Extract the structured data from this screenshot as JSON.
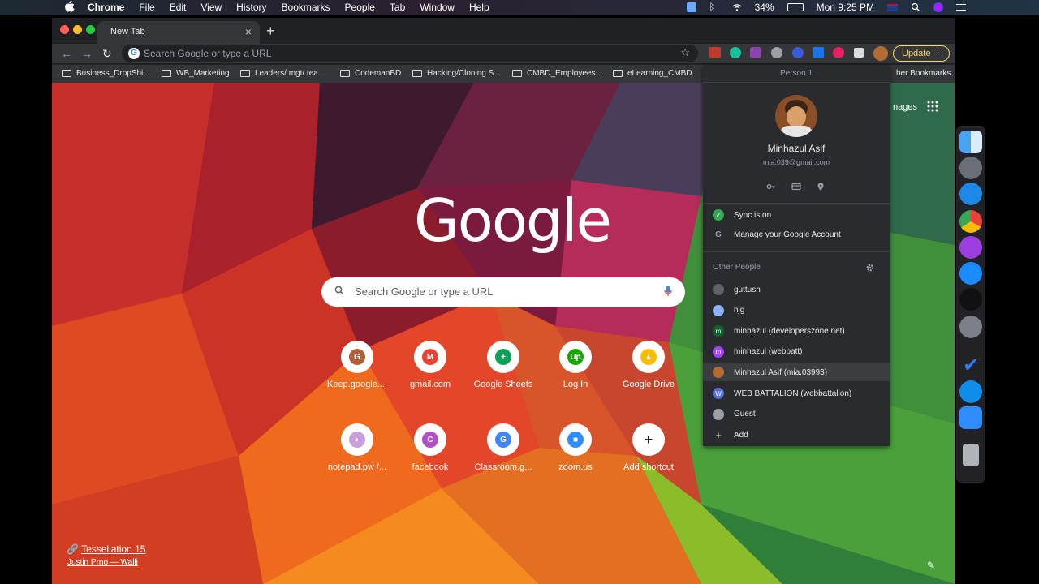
{
  "menubar": {
    "app": "Chrome",
    "menus": [
      "File",
      "Edit",
      "View",
      "History",
      "Bookmarks",
      "People",
      "Tab",
      "Window",
      "Help"
    ],
    "battery": "34%",
    "clock": "Mon 9:25 PM"
  },
  "browser": {
    "tab_title": "New Tab",
    "omnibox_placeholder": "Search Google or type a URL",
    "update_label": "Update",
    "bookmarks": [
      "Business_DropShi...",
      "WB_Marketing",
      "Leaders/ mgt/ tea...",
      "CodemanBD",
      "Hacking/Cloning S...",
      "CMBD_Employees...",
      "eLearning_CMBD"
    ],
    "other_bookmarks": "her Bookmarks"
  },
  "newtab": {
    "logo": "Google",
    "search_placeholder": "Search Google or type a URL",
    "images_link": "nages",
    "shortcuts": [
      {
        "label": "Keep.google....",
        "glyph": "G",
        "color": "#b0603a"
      },
      {
        "label": "gmail.com",
        "glyph": "M",
        "color": "#ea4335"
      },
      {
        "label": "Google Sheets",
        "glyph": "+",
        "color": "#0f9d58"
      },
      {
        "label": "Log In",
        "glyph": "Up",
        "color": "#14a800"
      },
      {
        "label": "Google Drive",
        "glyph": "▲",
        "color": "#fbbc05"
      },
      {
        "label": "notepad.pw /...",
        "glyph": "◗",
        "color": "#c9a0dc"
      },
      {
        "label": "facebook",
        "glyph": "C",
        "color": "#b04fc8"
      },
      {
        "label": "Classroom.g...",
        "glyph": "G",
        "color": "#4285f4"
      },
      {
        "label": "zoom.us",
        "glyph": "■",
        "color": "#2d8cff"
      },
      {
        "label": "Add shortcut",
        "glyph": "+",
        "color": "#202124"
      }
    ],
    "credit_title": "Tessellation 15",
    "credit_author": "Justin Prno — Walli"
  },
  "profile_panel": {
    "header": "Person 1",
    "name": "Minhazul Asif",
    "email": "mia.039@gmail.com",
    "sync": "Sync is on",
    "manage": "Manage your Google Account",
    "other_people_label": "Other People",
    "people": [
      {
        "label": "guttush",
        "glyph": "",
        "color": "#5f6368"
      },
      {
        "label": "hjg",
        "glyph": "",
        "color": "#8ab4f8"
      },
      {
        "label": "minhazul (developerszone.net)",
        "glyph": "m",
        "color": "#0d652d"
      },
      {
        "label": "minhazul (webbatt)",
        "glyph": "m",
        "color": "#a142f4"
      },
      {
        "label": "Minhazul Asif (mia.03993)",
        "glyph": "",
        "color": "#b36b32"
      },
      {
        "label": "WEB BATTALION (webbattalion)",
        "glyph": "W",
        "color": "#5a6fd6"
      },
      {
        "label": "Guest",
        "glyph": "",
        "color": "#9aa0a6"
      },
      {
        "label": "Add",
        "glyph": "+",
        "color": "transparent"
      }
    ]
  }
}
